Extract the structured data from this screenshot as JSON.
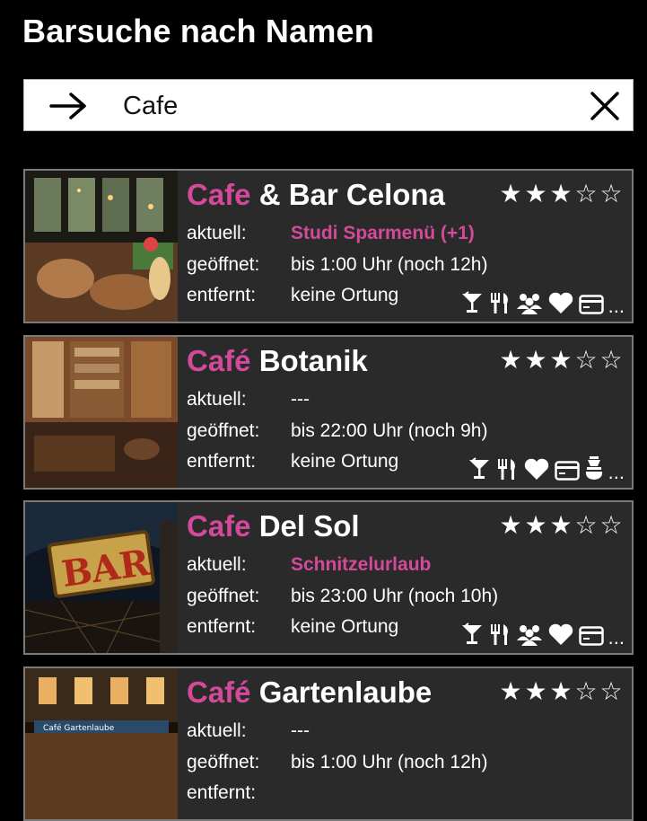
{
  "header": {
    "title": "Barsuche nach Namen"
  },
  "search": {
    "query": "Cafe"
  },
  "labels": {
    "current": "aktuell:",
    "open": "geöffnet:",
    "distance": "entfernt:"
  },
  "more": "...",
  "results": [
    {
      "title_highlight": "Cafe",
      "title_rest": " & Bar Celona",
      "rating": 3,
      "current": "Studi Sparmenü (+1)",
      "open": "bis 1:00 Uhr (noch 12h)",
      "distance": "keine Ortung",
      "icons": [
        "cocktail-icon",
        "food-icon",
        "group-icon",
        "heart-icon",
        "card-icon"
      ]
    },
    {
      "title_highlight": "Café",
      "title_rest": " Botanik",
      "rating": 3,
      "current": "---",
      "open": "bis 22:00 Uhr (noch 9h)",
      "distance": "keine Ortung",
      "icons": [
        "cocktail-icon",
        "food-icon",
        "heart-icon",
        "card-icon",
        "hookah-icon"
      ]
    },
    {
      "title_highlight": "Cafe",
      "title_rest": " Del Sol",
      "rating": 3,
      "current": "Schnitzelurlaub",
      "open": "bis 23:00 Uhr (noch 10h)",
      "distance": "keine Ortung",
      "icons": [
        "cocktail-icon",
        "food-icon",
        "group-icon",
        "heart-icon",
        "card-icon"
      ]
    },
    {
      "title_highlight": "Café",
      "title_rest": " Gartenlaube",
      "rating": 3,
      "current": "---",
      "open": "bis 1:00 Uhr (noch 12h)",
      "distance": "",
      "icons": []
    }
  ],
  "thumb_signs": {
    "bar_sign": "BAR",
    "gartenlaube_sign": "Café Gartenlaube"
  },
  "colors": {
    "highlight": "#d44a9a",
    "card_bg": "#2a2a2a",
    "card_border": "#7a7a7a"
  }
}
